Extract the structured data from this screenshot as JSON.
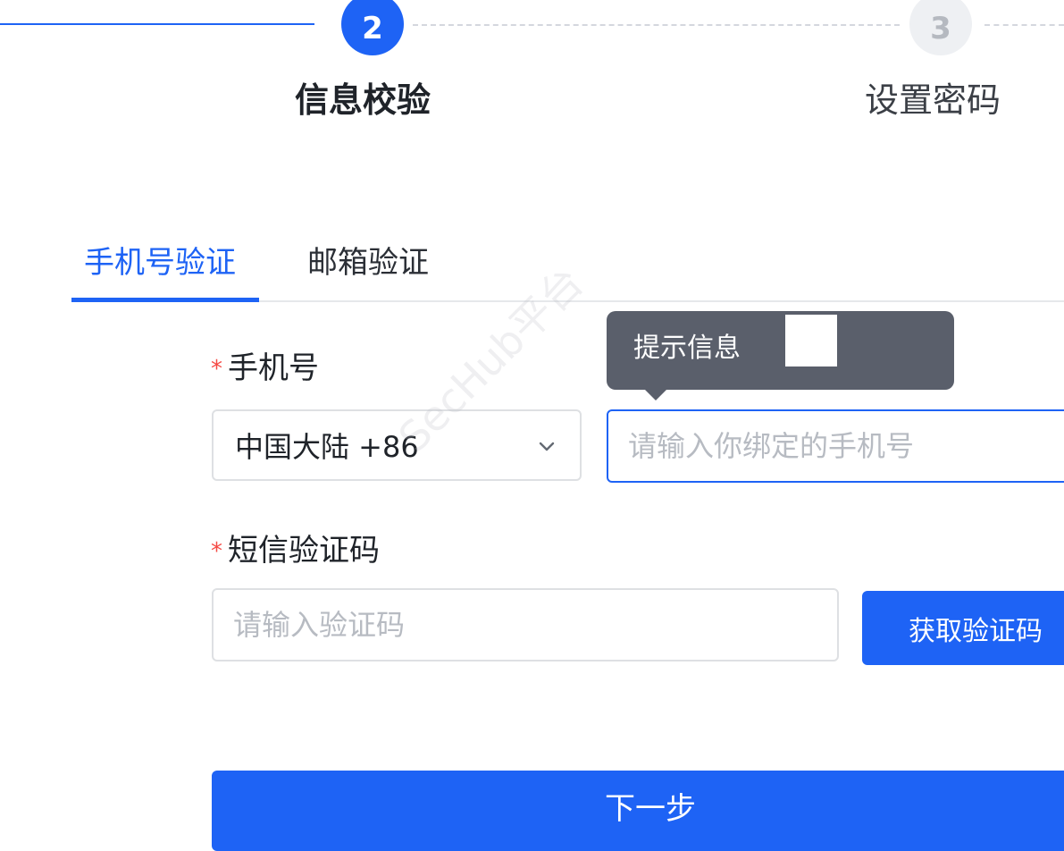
{
  "stepper": {
    "steps": [
      {
        "number": "2",
        "title": "信息校验",
        "state": "active"
      },
      {
        "number": "3",
        "title": "设置密码",
        "state": "todo"
      }
    ]
  },
  "tabs": [
    {
      "label": "手机号验证",
      "active": true
    },
    {
      "label": "邮箱验证",
      "active": false
    }
  ],
  "form": {
    "phone": {
      "label": "手机号",
      "required_mark": "*",
      "region": "中国大陆 +86",
      "placeholder": "请输入你绑定的手机号"
    },
    "sms": {
      "label": "短信验证码",
      "required_mark": "*",
      "placeholder": "请输入验证码",
      "button": "获取验证码"
    },
    "next_button": "下一步"
  },
  "tooltip": {
    "text": "提示信息"
  },
  "watermark": {
    "text": "SecHub平台"
  },
  "colors": {
    "accent": "#1e63f5",
    "required": "#f54a45",
    "tooltip_bg": "#5a5f6b"
  }
}
